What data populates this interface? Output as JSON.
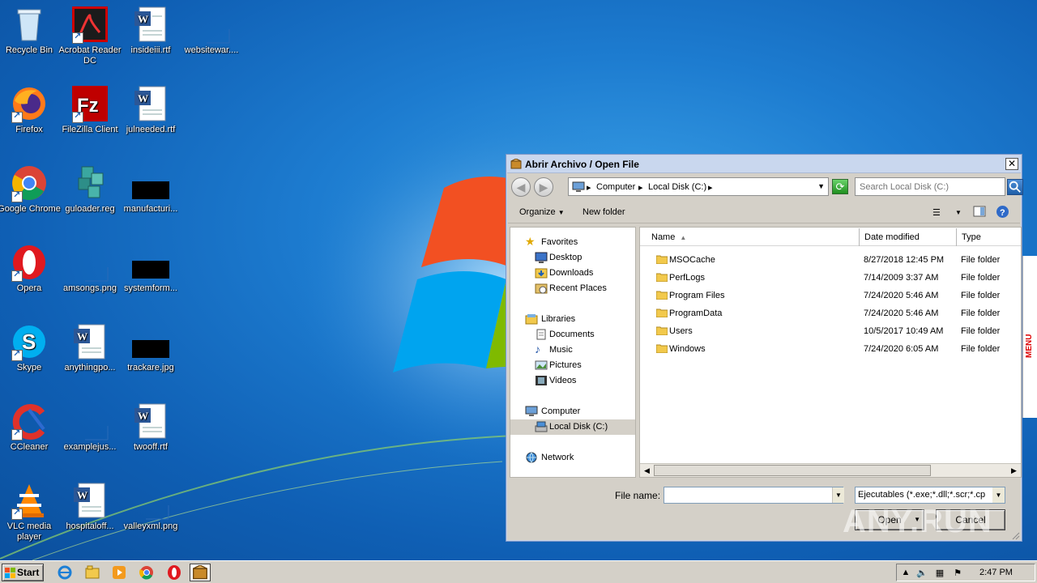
{
  "desktop": {
    "icons": [
      {
        "label": "Recycle Bin",
        "icon": "recycle-bin-icon"
      },
      {
        "label": "Acrobat Reader DC",
        "icon": "acrobat-icon"
      },
      {
        "label": "insideiii.rtf",
        "icon": "word-doc-icon"
      },
      {
        "label": "websitewar....",
        "icon": "blank-file-icon"
      },
      {
        "label": "Firefox",
        "icon": "firefox-icon"
      },
      {
        "label": "FileZilla Client",
        "icon": "filezilla-icon"
      },
      {
        "label": "julneeded.rtf",
        "icon": "word-doc-icon"
      },
      {
        "label": "Google Chrome",
        "icon": "chrome-icon"
      },
      {
        "label": "guloader.reg",
        "icon": "registry-icon"
      },
      {
        "label": "manufacturi...",
        "icon": "black-thumbnail-icon"
      },
      {
        "label": "Opera",
        "icon": "opera-icon"
      },
      {
        "label": "amsongs.png",
        "icon": "blank-file-icon"
      },
      {
        "label": "systemform...",
        "icon": "black-thumbnail-icon"
      },
      {
        "label": "Skype",
        "icon": "skype-icon"
      },
      {
        "label": "anythingpo...",
        "icon": "word-doc-icon"
      },
      {
        "label": "trackare.jpg",
        "icon": "black-thumbnail-icon"
      },
      {
        "label": "CCleaner",
        "icon": "ccleaner-icon"
      },
      {
        "label": "examplejus...",
        "icon": "blank-file-icon"
      },
      {
        "label": "twooff.rtf",
        "icon": "word-doc-icon"
      },
      {
        "label": "VLC media player",
        "icon": "vlc-icon"
      },
      {
        "label": "hospitaloff...",
        "icon": "word-doc-icon"
      },
      {
        "label": "valleyxml.png",
        "icon": "blank-file-icon"
      }
    ]
  },
  "dialog": {
    "title": "Abrir Archivo / Open File",
    "close_label": "✕",
    "address": {
      "crumbs": [
        "Computer",
        "Local Disk (C:)"
      ]
    },
    "search_placeholder": "Search Local Disk (C:)",
    "toolbar": {
      "organize": "Organize",
      "new_folder": "New folder"
    },
    "nav": {
      "favorites": "Favorites",
      "desktop": "Desktop",
      "downloads": "Downloads",
      "recent": "Recent Places",
      "libraries": "Libraries",
      "documents": "Documents",
      "music": "Music",
      "pictures": "Pictures",
      "videos": "Videos",
      "computer": "Computer",
      "local_disk": "Local Disk (C:)",
      "network": "Network"
    },
    "columns": {
      "name": "Name",
      "date": "Date modified",
      "type": "Type"
    },
    "files": [
      {
        "name": "MSOCache",
        "date": "8/27/2018 12:45 PM",
        "type": "File folder"
      },
      {
        "name": "PerfLogs",
        "date": "7/14/2009 3:37 AM",
        "type": "File folder"
      },
      {
        "name": "Program Files",
        "date": "7/24/2020 5:46 AM",
        "type": "File folder"
      },
      {
        "name": "ProgramData",
        "date": "7/24/2020 5:46 AM",
        "type": "File folder"
      },
      {
        "name": "Users",
        "date": "10/5/2017 10:49 AM",
        "type": "File folder"
      },
      {
        "name": "Windows",
        "date": "7/24/2020 6:05 AM",
        "type": "File folder"
      }
    ],
    "file_name_label": "File name:",
    "file_name_value": "",
    "filter_value": "Ejecutables (*.exe;*.dll;*.scr;*.cp",
    "open_label": "Open",
    "cancel_label": "Cancel"
  },
  "side_peek_text": "MENU",
  "watermark": "ANY.RUN",
  "taskbar": {
    "start_label": "Start",
    "clock": "2:47 PM"
  },
  "colors": {
    "desktop_blue": "#1d7cd0",
    "dialog_bg": "#d4d0c8",
    "folder_yellow": "#f2c94c"
  }
}
